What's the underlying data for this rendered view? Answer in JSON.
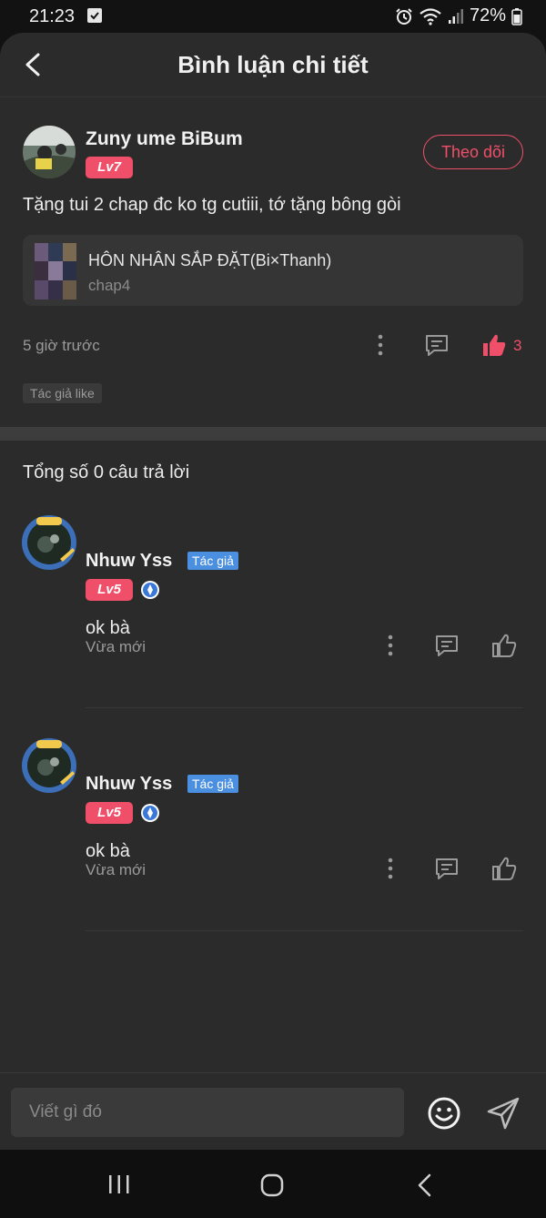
{
  "status_bar": {
    "time": "21:23",
    "battery": "72%"
  },
  "header": {
    "title": "Bình luận chi tiết"
  },
  "comment": {
    "user_name": "Zuny ume BiBum",
    "level": "Lv7",
    "follow_label": "Theo dõi",
    "text": "Tặng tui 2 chap đc ko tg cutiii, tớ tặng bông gòi",
    "work": {
      "title": "HÔN NHÂN SẮP ĐẶT(Bi×Thanh)",
      "chapter": "chap4"
    },
    "time": "5 giờ trước",
    "like_count": "3",
    "author_like_label": "Tác giả like"
  },
  "replies_summary": "Tổng số 0 câu trả lời",
  "replies": [
    {
      "user_name": "Nhuw Yss",
      "author_tag": "Tác giả",
      "level": "Lv5",
      "text": "ok bà",
      "time": "Vừa mới"
    },
    {
      "user_name": "Nhuw Yss",
      "author_tag": "Tác giả",
      "level": "Lv5",
      "text": "ok bà",
      "time": "Vừa mới"
    }
  ],
  "input": {
    "placeholder": "Viết gì đó"
  },
  "colors": {
    "accent": "#f04f6a",
    "author_tag": "#4a8fe0",
    "background": "#2b2b2b"
  },
  "icons": [
    "back-icon",
    "more-icon",
    "comment-icon",
    "like-icon",
    "emoji-icon",
    "send-icon",
    "shield-icon"
  ]
}
